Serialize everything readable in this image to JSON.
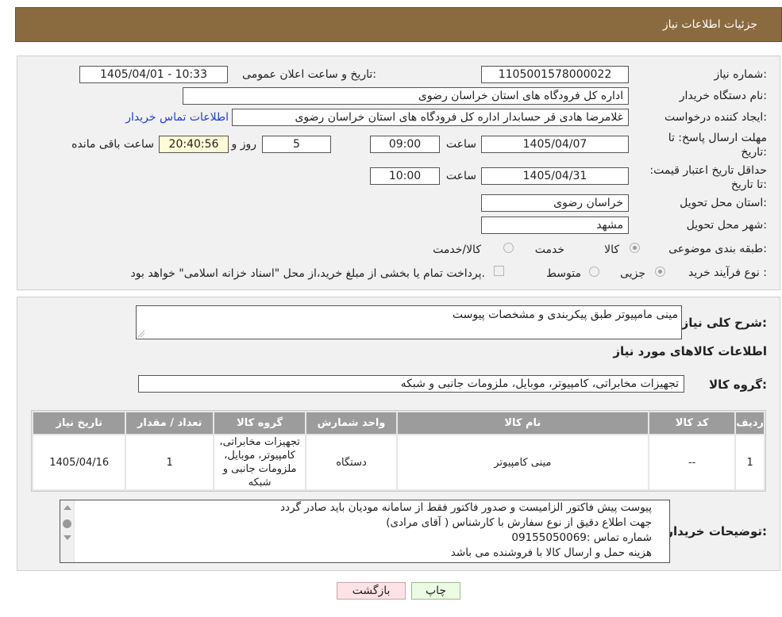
{
  "header": {
    "title": "جزئیات اطلاعات نیاز"
  },
  "form": {
    "need_number_label": "شماره نیاز:",
    "need_number": "1105001578000022",
    "announce_label": "تاریخ و ساعت اعلان عمومی:",
    "announce_value": "1405/04/01 - 10:33",
    "buyer_org_label": "نام دستگاه خریدار:",
    "buyer_org": "اداره کل فرودگاه های استان خراسان رضوی",
    "creator_label": "ایجاد کننده درخواست:",
    "creator": "غلامرضا هادی قر حسابدار اداره کل فرودگاه های استان خراسان رضوی",
    "contact_link": "اطلاعات تماس خریدار",
    "deadline_label": "مهلت ارسال پاسخ: تا تاریخ:",
    "deadline_date": "1405/04/07",
    "time_label": "ساعت",
    "deadline_time": "09:00",
    "days_value": "5",
    "days_label": "روز و",
    "remaining_time": "20:40:56",
    "remaining_label": "ساعت باقی مانده",
    "validity_label": "حداقل تاریخ اعتبار قیمت: تا تاریخ:",
    "validity_date": "1405/04/31",
    "validity_time": "10:00",
    "province_label": "استان محل تحویل:",
    "province": "خراسان رضوی",
    "city_label": "شهر محل تحویل:",
    "city": "مشهد",
    "category_label": "طبقه بندی موضوعی:",
    "category_options": [
      "کالا",
      "خدمت",
      "کالا/خدمت"
    ],
    "process_label": "نوع فرآیند خرید :",
    "process_options": [
      "جزیی",
      "متوسط"
    ],
    "payment_note": "پرداخت تمام یا بخشی از مبلغ خرید،از محل \"اسناد خزانه اسلامی\" خواهد بود."
  },
  "details": {
    "summary_label": "شرح کلی نیاز:",
    "summary": "مینی مامپیوتر طبق پیکربندی و مشخصات پیوست",
    "goods_info_title": "اطلاعات کالاهای مورد نیاز",
    "goods_group_label": "گروه کالا:",
    "goods_group": "تجهیزات مخابراتی، کامپیوتر، موبایل، ملزومات جانبی و شبکه",
    "table_headers": [
      "ردیف",
      "کد کالا",
      "نام کالا",
      "واحد شمارش",
      "گروه کالا",
      "تعداد / مقدار",
      "تاریخ نیاز"
    ],
    "rows": [
      {
        "row": "1",
        "code": "--",
        "name": "مینی کامپیوتر",
        "unit": "دستگاه",
        "group": "تجهیزات مخابراتی، کامپیوتر، موبایل، ملزومات جانبی و شبکه",
        "qty": "1",
        "date": "1405/04/16"
      }
    ],
    "buyer_notes_label": "توضیحات خریدار:",
    "buyer_notes": [
      "پیوست پیش فاکتور الزامیست و صدور فاکتور فقط از سامانه مودیان باید صادر گردد",
      "جهت اطلاع دقیق از نوع سفارش با کارشناس  ( آقای مرادی)",
      "شماره تماس :09155050069",
      "هزینه حمل و ارسال کالا با فروشنده می باشد"
    ]
  },
  "buttons": {
    "print": "چاپ",
    "back": "بازگشت"
  },
  "colors": {
    "header": "#8a6a3f",
    "table_header": "#9c9c9c",
    "link": "#1f3fd6",
    "back_button": "#fde2e6",
    "print_button": "#ecfbe4"
  }
}
